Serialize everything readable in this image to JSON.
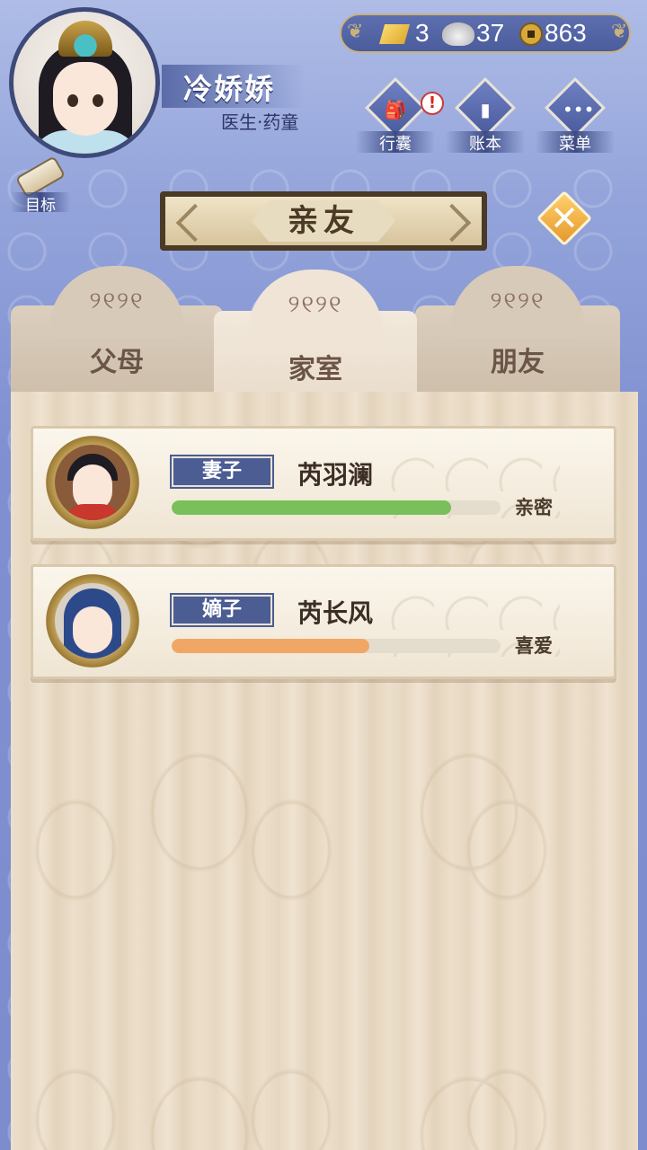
{
  "player": {
    "name": "冷娇娇",
    "role": "医生·药童"
  },
  "currency": {
    "gold": "3",
    "silver": "37",
    "coins": "863"
  },
  "menu_buttons": [
    {
      "label": "行囊",
      "icon": "bag-icon",
      "alert": "!"
    },
    {
      "label": "账本",
      "icon": "ledger-icon"
    },
    {
      "label": "菜单",
      "icon": "more-dots-icon"
    }
  ],
  "goal_label": "目标",
  "dialog": {
    "title": "亲友",
    "close_icon": "close-icon"
  },
  "tabs": [
    {
      "label": "父母",
      "active": false
    },
    {
      "label": "家室",
      "active": true
    },
    {
      "label": "朋友",
      "active": false
    }
  ],
  "relatives": [
    {
      "role": "妻子",
      "name": "芮羽澜",
      "relation": "亲密",
      "affinity": 0.85,
      "bar_color": "#79bf5a"
    },
    {
      "role": "嫡子",
      "name": "芮长风",
      "relation": "喜爱",
      "affinity": 0.6,
      "bar_color": "#f0a766"
    }
  ],
  "colors": {
    "accent": "#4b5d93",
    "gold_border": "#c9b27c",
    "close_button": "#f2b24a"
  }
}
